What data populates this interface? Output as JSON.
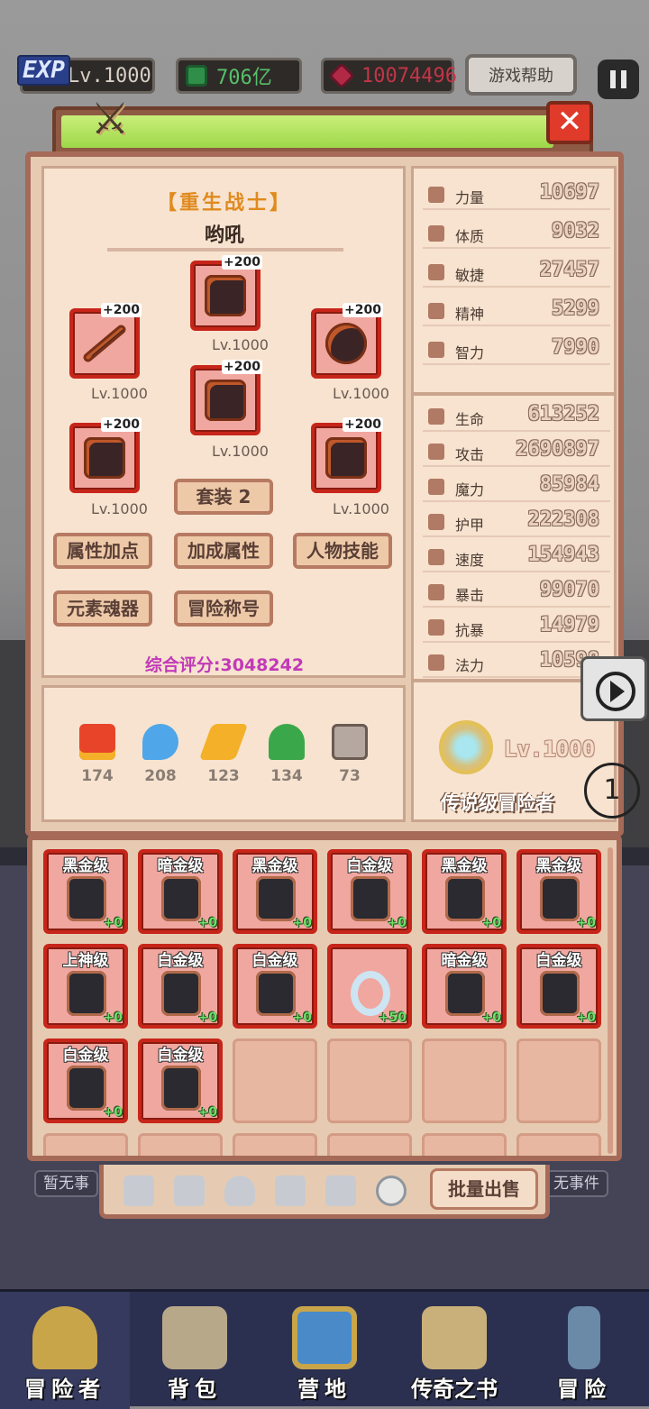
{
  "topbar": {
    "exp_badge": "EXP",
    "level": "Lv.1000",
    "gems": "706亿",
    "rubies": "10074496",
    "help_label": "游戏帮助"
  },
  "character": {
    "class_name": "【重生战士】",
    "name": "哟吼",
    "equipment": [
      {
        "slot": "helmet",
        "plus": "+200",
        "level": "Lv.1000"
      },
      {
        "slot": "weapon",
        "plus": "+200",
        "level": "Lv.1000"
      },
      {
        "slot": "shield",
        "plus": "+200",
        "level": "Lv.1000"
      },
      {
        "slot": "armor",
        "plus": "+200",
        "level": "Lv.1000"
      },
      {
        "slot": "gloves",
        "plus": "+200",
        "level": "Lv.1000"
      },
      {
        "slot": "boots",
        "plus": "+200",
        "level": "Lv.1000"
      }
    ],
    "set_button": "套装 2",
    "buttons": [
      "属性加点",
      "加成属性",
      "人物技能",
      "元素魂器",
      "冒险称号"
    ],
    "score_label": "综合评分:3048242"
  },
  "elements": [
    {
      "icon": "fire-icon",
      "value": "174"
    },
    {
      "icon": "water-icon",
      "value": "208"
    },
    {
      "icon": "lightning-icon",
      "value": "123"
    },
    {
      "icon": "leaf-icon",
      "value": "134"
    },
    {
      "icon": "skull-icon",
      "value": "73"
    }
  ],
  "base_stats": [
    {
      "label": "力量",
      "value": "10697"
    },
    {
      "label": "体质",
      "value": "9032"
    },
    {
      "label": "敏捷",
      "value": "27457"
    },
    {
      "label": "精神",
      "value": "5299"
    },
    {
      "label": "智力",
      "value": "7990"
    }
  ],
  "combat_stats": [
    {
      "label": "生命",
      "value": "613252"
    },
    {
      "label": "攻击",
      "value": "2690897"
    },
    {
      "label": "魔力",
      "value": "85984"
    },
    {
      "label": "护甲",
      "value": "222308"
    },
    {
      "label": "速度",
      "value": "154943"
    },
    {
      "label": "暴击",
      "value": "99070"
    },
    {
      "label": "抗暴",
      "value": "14979"
    },
    {
      "label": "法力",
      "value": "10598"
    }
  ],
  "legend": {
    "level": "Lv.1000",
    "title": "传说级冒险者"
  },
  "inventory": [
    {
      "grade": "黑金级",
      "enh": "+0",
      "kind": "gloves"
    },
    {
      "grade": "暗金级",
      "enh": "+0",
      "kind": "gloves"
    },
    {
      "grade": "黑金级",
      "enh": "+0",
      "kind": "gloves"
    },
    {
      "grade": "白金级",
      "enh": "+0",
      "kind": "gloves"
    },
    {
      "grade": "黑金级",
      "enh": "+0",
      "kind": "gloves"
    },
    {
      "grade": "黑金级",
      "enh": "+0",
      "kind": "gloves"
    },
    {
      "grade": "上神级",
      "enh": "+0",
      "kind": "gauntlet"
    },
    {
      "grade": "白金级",
      "enh": "+0",
      "kind": "gloves"
    },
    {
      "grade": "白金级",
      "enh": "+0",
      "kind": "gloves"
    },
    {
      "grade": "",
      "enh": "+50",
      "kind": "ring"
    },
    {
      "grade": "暗金级",
      "enh": "+0",
      "kind": "gauntlet"
    },
    {
      "grade": "白金级",
      "enh": "+0",
      "kind": "gloves"
    },
    {
      "grade": "白金级",
      "enh": "+0",
      "kind": "gloves"
    },
    {
      "grade": "白金级",
      "enh": "+0",
      "kind": "gauntlet"
    }
  ],
  "tabs": {
    "icons": [
      "sword-icon",
      "shield-icon",
      "helmet-icon",
      "armor-icon",
      "boots-icon",
      "ring-icon"
    ],
    "sell_label": "批量出售"
  },
  "notes": {
    "left": "暂无事",
    "right": "无事件"
  },
  "overlay": {
    "marker": "1"
  },
  "bottom_nav": [
    {
      "label": "冒险者",
      "icon": "knight-helmet-icon"
    },
    {
      "label": "背包",
      "icon": "backpack-icon"
    },
    {
      "label": "营地",
      "icon": "camp-banner-icon"
    },
    {
      "label": "传奇之书",
      "icon": "book-icon"
    },
    {
      "label": "冒险",
      "icon": "sword-quest-icon"
    }
  ]
}
